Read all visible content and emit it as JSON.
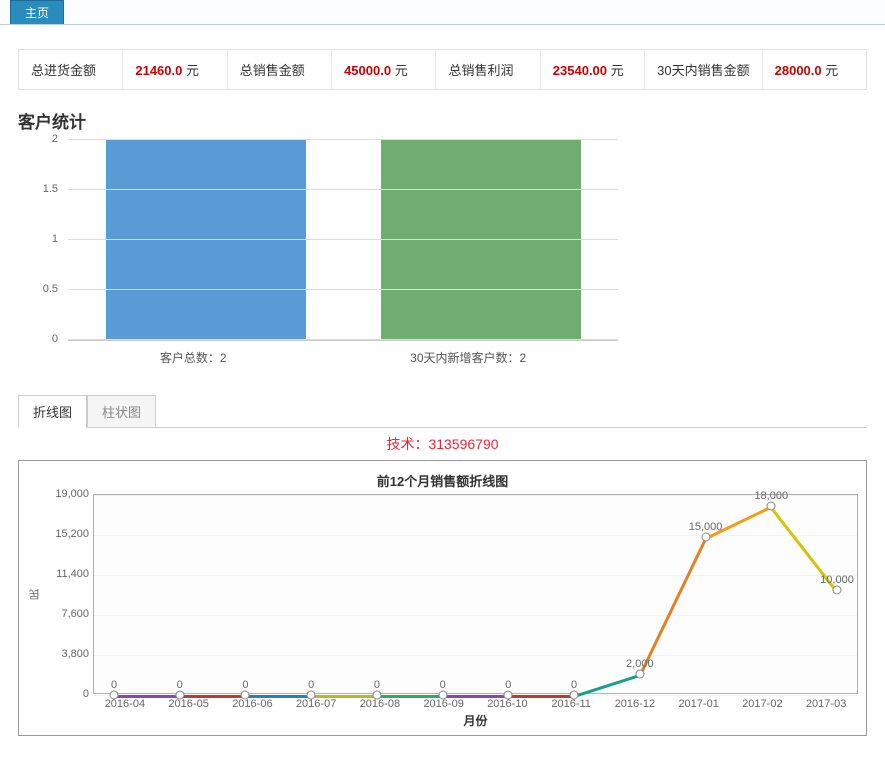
{
  "top_tab": "主页",
  "stats": [
    {
      "label": "总进货金额",
      "value": "21460.0",
      "unit": "元"
    },
    {
      "label": "总销售金额",
      "value": "45000.0",
      "unit": "元"
    },
    {
      "label": "总销售利润",
      "value": "23540.00",
      "unit": "元"
    },
    {
      "label": "30天内销售金额",
      "value": "28000.0",
      "unit": "元"
    }
  ],
  "bar_section_title": "客户统计",
  "chart_tabs": [
    "折线图",
    "柱状图"
  ],
  "chart_tab_active": 0,
  "watermark": "技术：313596790",
  "line_title": "前12个月销售额折线图",
  "line_ylabel": "民",
  "line_xlabel": "月份",
  "chart_data": {
    "bar": {
      "type": "bar",
      "categories": [
        "客户总数：2",
        "30天内新增客户数：2"
      ],
      "values": [
        2,
        2
      ],
      "colors": [
        "#5b9bd5",
        "#70ad70"
      ],
      "ylim": [
        0,
        2
      ],
      "yticks": [
        0,
        0.5,
        1,
        1.5,
        2
      ]
    },
    "line": {
      "type": "line",
      "title": "前12个月销售额折线图",
      "xlabel": "月份",
      "ylabel": "民",
      "ylim": [
        0,
        19000
      ],
      "yticks": [
        0,
        3800,
        7600,
        11400,
        15200,
        19000
      ],
      "x": [
        "2016-04",
        "2016-05",
        "2016-06",
        "2016-07",
        "2016-08",
        "2016-09",
        "2016-10",
        "2016-11",
        "2016-12",
        "2017-01",
        "2017-02",
        "2017-03"
      ],
      "values": [
        0,
        0,
        0,
        0,
        0,
        0,
        0,
        0,
        2000,
        15000,
        18000,
        10000
      ],
      "data_labels": [
        "0",
        "0",
        "0",
        "0",
        "0",
        "0",
        "0",
        "0",
        "2,000",
        "15,000",
        "18,000",
        "10,000"
      ],
      "seg_colors": [
        "#8e44ad",
        "#c0392b",
        "#2980b9",
        "#b8b823",
        "#27ae60",
        "#8e44ad",
        "#c0392b",
        "#16a085",
        "#e67e22",
        "#f39c12",
        "#d4c40a"
      ]
    }
  }
}
